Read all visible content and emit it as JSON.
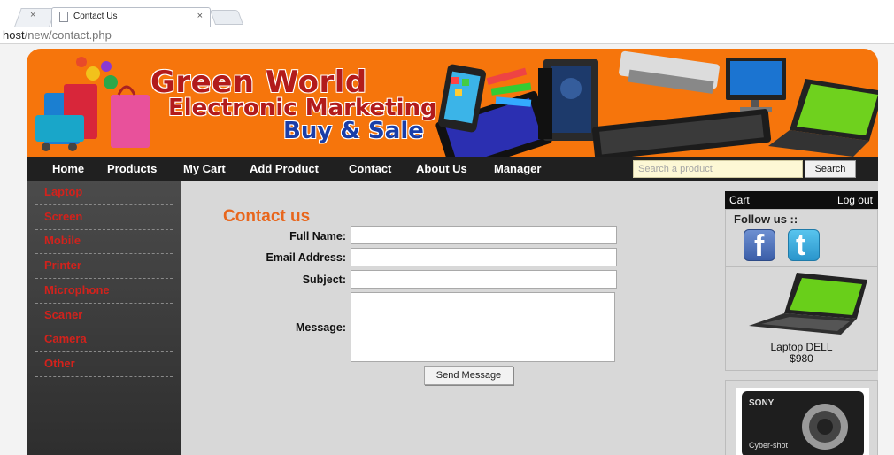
{
  "browser": {
    "tab_title": "Contact Us",
    "tab_close": "×",
    "ghost_close": "×",
    "url_host": "host",
    "url_path": "/new/contact.php"
  },
  "banner": {
    "line1": "Green World",
    "line2": "Electronic Marketing",
    "line3": "Buy & Sale"
  },
  "nav": {
    "links": [
      "Home",
      "Products",
      "My Cart",
      "Add Product",
      "Contact",
      "About Us",
      "Manager"
    ],
    "search_placeholder": "Search a product",
    "search_button": "Search"
  },
  "sidebar": {
    "categories": [
      "Laptop",
      "Screen",
      "Mobile",
      "Printer",
      "Microphone",
      "Scaner",
      "Camera",
      "Other"
    ]
  },
  "contact": {
    "title": "Contact us",
    "fields": {
      "full_name": "Full Name:",
      "email": "Email Address:",
      "subject": "Subject:",
      "message": "Message:"
    },
    "send_button": "Send Message"
  },
  "right": {
    "cart": "Cart",
    "logout": "Log out",
    "follow": "Follow us ::",
    "product1_name": "Laptop DELL",
    "product1_price": "$980",
    "camera_brand": "SONY",
    "camera_model": "Cyber-shot"
  },
  "colors": {
    "banner_orange": "#f6750c",
    "nav_black": "#202020",
    "category_red": "#d2221c",
    "title_orange": "#e8661c"
  }
}
